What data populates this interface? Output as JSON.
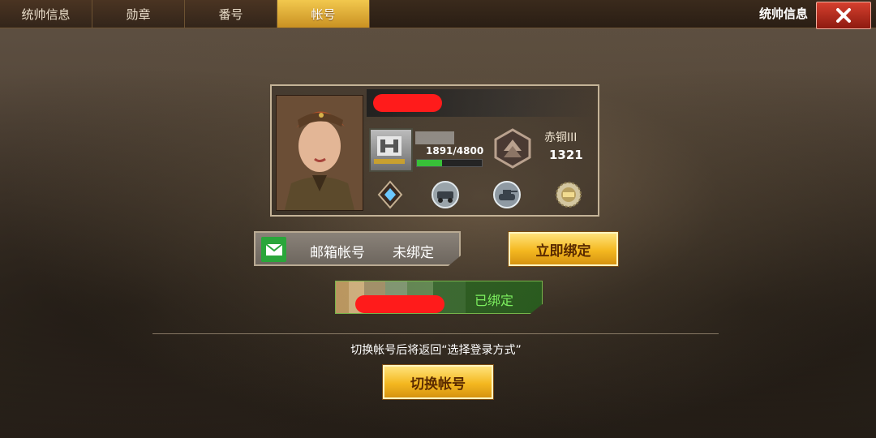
{
  "tabs": [
    {
      "label": "统帅信息",
      "active": false
    },
    {
      "label": "勋章",
      "active": false
    },
    {
      "label": "番号",
      "active": false
    },
    {
      "label": "帐号",
      "active": true
    }
  ],
  "header": {
    "title": "统帅信息"
  },
  "profile": {
    "exp_text": "1891/4800",
    "exp_fraction": 0.39,
    "tier_name": "赤铜III",
    "tier_score": "1321"
  },
  "email_binding": {
    "label": "邮箱帐号",
    "status": "未绑定",
    "button": "立即绑定"
  },
  "bound_account": {
    "status": "已绑定"
  },
  "note": "切换帐号后将返回“选择登录方式”",
  "switch_button": "切换帐号",
  "icons": {
    "close": "close-icon",
    "mail": "mail-icon",
    "rank": "rank-insignia-icon",
    "tier": "tier-badge-icon",
    "medals": [
      "diamond-medal-icon",
      "armored-car-medal-icon",
      "tank-medal-icon",
      "gear-medal-icon"
    ]
  },
  "colors": {
    "accent_gold": "#f4b820",
    "bound_green": "#7df05f",
    "close_red": "#d5402e",
    "mail_green": "#2aa63b"
  }
}
